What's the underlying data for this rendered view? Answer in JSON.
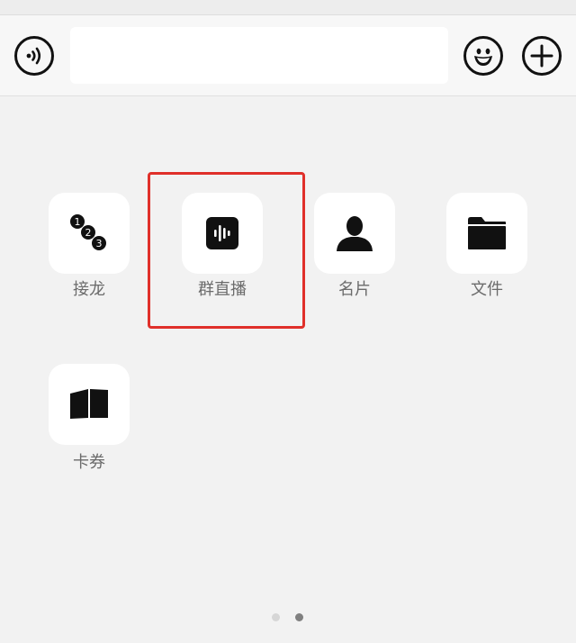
{
  "input_bar": {
    "voice_icon": "voice-wave-icon",
    "text_value": "",
    "emoji_icon": "smiley-face-icon",
    "plus_icon": "plus-icon"
  },
  "apps": [
    {
      "label": "接龙",
      "icon": "numbered-chain-icon"
    },
    {
      "label": "群直播",
      "icon": "live-audio-icon"
    },
    {
      "label": "名片",
      "icon": "person-card-icon"
    },
    {
      "label": "文件",
      "icon": "folder-icon"
    },
    {
      "label": "卡券",
      "icon": "ticket-coupon-icon"
    }
  ],
  "chain_numbers": [
    "1",
    "2",
    "3"
  ],
  "highlighted_app": "群直播",
  "pager": {
    "total": 2,
    "active": 2
  },
  "colors": {
    "highlight": "#e0302a",
    "label": "#6b6b6b",
    "background": "#f2f2f2",
    "tile": "#ffffff",
    "icon": "#111111",
    "dot_inactive": "#d6d6d6",
    "dot_active": "#808080"
  }
}
